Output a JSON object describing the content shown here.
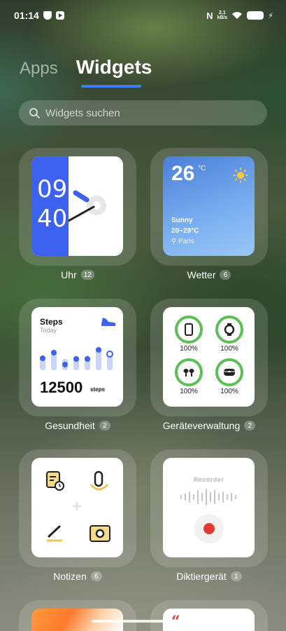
{
  "status_bar": {
    "time": "01:14",
    "speed_top": "2,1",
    "speed_bottom": "kB/s"
  },
  "tabs": [
    {
      "label": "Apps"
    },
    {
      "label": "Widgets"
    }
  ],
  "search": {
    "placeholder": "Widgets suchen"
  },
  "widgets": [
    {
      "name": "Uhr",
      "count": "12",
      "hours": "09",
      "minutes": "40"
    },
    {
      "name": "Wetter",
      "count": "6",
      "temp": "26",
      "unit": "°C",
      "condition": "Sunny",
      "range": "20~29°C",
      "location": "Paris"
    },
    {
      "name": "Gesundheit",
      "count": "2",
      "title": "Steps",
      "subtitle": "Today",
      "steps": "12500",
      "steps_unit": "steps"
    },
    {
      "name": "Geräteverwaltung",
      "count": "2",
      "devices": [
        {
          "icon": "phone-icon",
          "percent": "100%"
        },
        {
          "icon": "watch-icon",
          "percent": "100%"
        },
        {
          "icon": "earbuds-icon",
          "percent": "100%"
        },
        {
          "icon": "case-icon",
          "percent": "100%"
        }
      ]
    },
    {
      "name": "Notizen",
      "count": "6"
    },
    {
      "name": "Diktiergerät",
      "count": "1",
      "title": "Recorder"
    }
  ],
  "colors": {
    "accent": "#3b7ff2",
    "clock_blue": "#3d62f0",
    "device_green": "#5bbf56",
    "record_red": "#e53935"
  }
}
